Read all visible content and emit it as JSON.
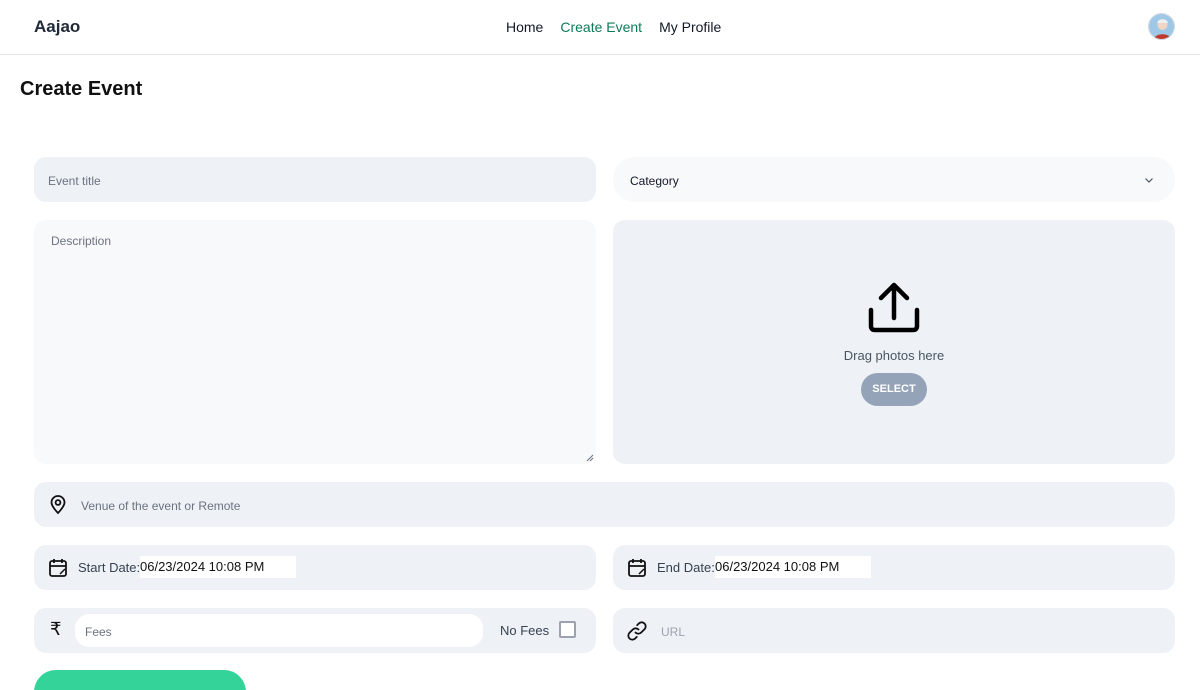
{
  "navbar": {
    "brand": "Aajao",
    "links": [
      {
        "label": "Home"
      },
      {
        "label": "Create Event"
      },
      {
        "label": "My Profile"
      }
    ],
    "active_link": "Create Event"
  },
  "page": {
    "title": "Create Event"
  },
  "form": {
    "event_title_placeholder": "Event title",
    "category_label": "Category",
    "description_placeholder": "Description",
    "upload": {
      "drag_text": "Drag photos here",
      "select_label": "SELECT"
    },
    "venue_placeholder": "Venue of the event or Remote",
    "start_date": {
      "label": "Start Date:",
      "value": "06/23/2024 10:08 PM"
    },
    "end_date": {
      "label": "End Date:",
      "value": "06/23/2024 10:08 PM"
    },
    "fees": {
      "symbol": "₹",
      "placeholder": "Fees",
      "no_fees_label": "No Fees",
      "no_fees_checked": false
    },
    "url_placeholder": "URL"
  },
  "icons": {
    "avatar": "profile-avatar",
    "category": "chevron-down-icon",
    "upload": "upload-icon",
    "venue": "location-pin-icon",
    "date": "calendar-icon",
    "url": "link-icon"
  },
  "colors": {
    "accent": "#0f7a57",
    "field_bg": "#eef2f6",
    "field_bg_light": "#f8f9fb",
    "select_button": "#94a3b8",
    "submit_button": "#34d399"
  }
}
